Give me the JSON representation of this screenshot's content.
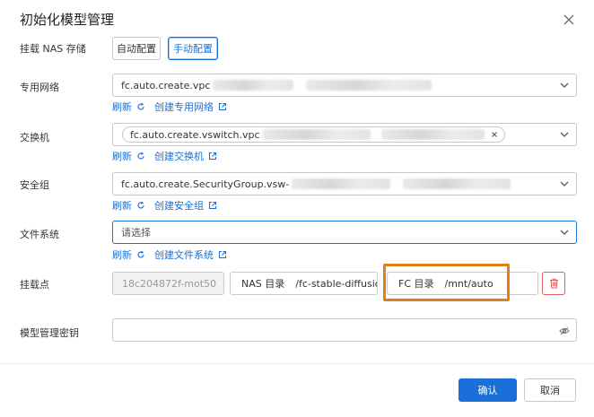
{
  "dialog": {
    "title": "初始化模型管理",
    "close_icon": "close-icon"
  },
  "mount_nas": {
    "label": "挂载 NAS 存储",
    "options": [
      "自动配置",
      "手动配置"
    ],
    "selected": "手动配置"
  },
  "vpc": {
    "label": "专用网络",
    "value": "fc.auto.create.vpc",
    "refresh": "刷新",
    "create": "创建专用网络"
  },
  "vswitch": {
    "label": "交换机",
    "tag": "fc.auto.create.vswitch.vpc",
    "refresh": "刷新",
    "create": "创建交换机"
  },
  "security_group": {
    "label": "安全组",
    "value": "fc.auto.create.SecurityGroup.vsw-",
    "refresh": "刷新",
    "create": "创建安全组"
  },
  "file_system": {
    "label": "文件系统",
    "placeholder": "请选择",
    "refresh": "刷新",
    "create": "创建文件系统"
  },
  "mount_point": {
    "label": "挂载点",
    "id_value": "18c204872f-mot50",
    "nas_dir_label": "NAS 目录",
    "nas_dir_value": "/fc-stable-diffusion-",
    "fc_dir_label": "FC 目录",
    "fc_dir_value": "/mnt/auto"
  },
  "key": {
    "label": "模型管理密钥",
    "value": ""
  },
  "footer": {
    "confirm": "确认",
    "cancel": "取消"
  },
  "colors": {
    "primary": "#1b6fd8",
    "highlight": "#e27e19",
    "danger": "#e06060"
  }
}
